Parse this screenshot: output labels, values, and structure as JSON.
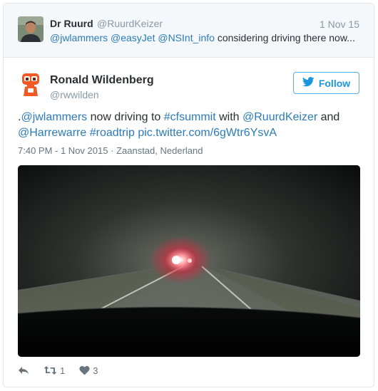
{
  "parent_tweet": {
    "name": "Dr Ruurd",
    "handle": "@RuurdKeizer",
    "date": "1 Nov 15",
    "mentions": [
      "@jwlammers",
      "@easyJet",
      "@NSInt_info"
    ],
    "text_rest": "considering driving there now..."
  },
  "tweet": {
    "name": "Ronald Wildenberg",
    "handle": "@rwwilden",
    "follow_label": "Follow",
    "text": {
      "prefix": ".",
      "m1": "@jwlammers",
      "t1": " now driving to ",
      "h1": "#cfsummit",
      "t2": " with ",
      "m2": "@RuurdKeizer",
      "t3": " and ",
      "m3": "@Harrewarre",
      "t4": " ",
      "h2": "#roadtrip",
      "t5": " ",
      "link": "pic.twitter.com/6gWtr6YsvA"
    },
    "timestamp": "7:40 PM - 1 Nov 2015",
    "separator": "·",
    "location": "Zaanstad, Nederland"
  },
  "actions": {
    "retweet_count": "1",
    "like_count": "3"
  },
  "icons": {
    "follow": "twitter-bird-icon",
    "reply": "reply-icon",
    "retweet": "retweet-icon",
    "like": "heart-icon"
  },
  "colors": {
    "link": "#2b7bb9",
    "follow": "#1b95e0",
    "muted": "#8899a6",
    "parent_bg": "#f5f8fa",
    "avatar_orange": "#f15a24"
  }
}
